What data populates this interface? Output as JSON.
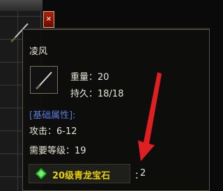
{
  "window": {
    "close_label": "×"
  },
  "tooltip": {
    "item_name": "凌风",
    "weight": "重量：20",
    "durability": "持久：18/18",
    "section_header": "[基础属性]:",
    "attack": "攻击：6-12",
    "required_level": "需要等级：19",
    "gem": {
      "icon": "green-gem-icon",
      "name": "20级青龙宝石",
      "separator": "：",
      "count": "2"
    }
  },
  "annotation": {
    "arrow_color": "#e02020"
  },
  "colors": {
    "text": "#e8e4d8",
    "section_header": "#5a7ad8",
    "gem_name": "#e8d000"
  }
}
